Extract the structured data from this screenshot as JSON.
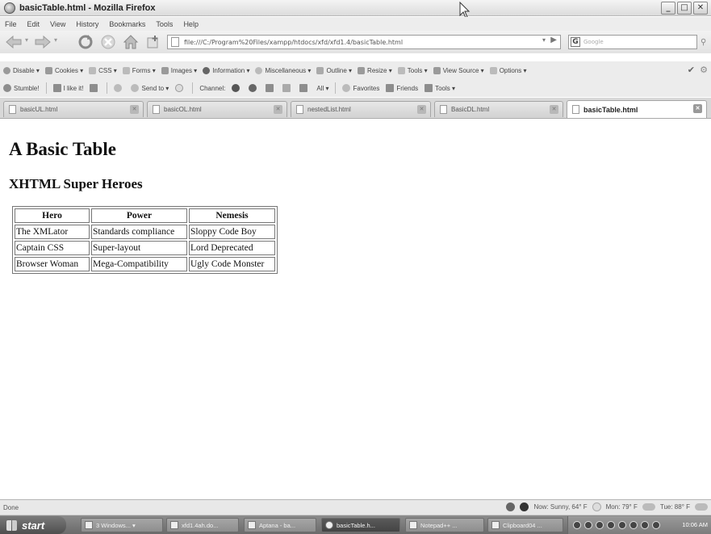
{
  "window": {
    "title": "basicTable.html - Mozilla Firefox",
    "controls": {
      "minimize": "_",
      "maximize": "□",
      "close": "✕"
    }
  },
  "menu": [
    "File",
    "Edit",
    "View",
    "History",
    "Bookmarks",
    "Tools",
    "Help"
  ],
  "nav": {
    "url": "file:///C:/Program%20Files/xampp/htdocs/xfd/xfd1.4/basicTable.html",
    "search_placeholder": "Google",
    "search_engine": "G"
  },
  "devbar": [
    "Disable",
    "Cookies",
    "CSS",
    "Forms",
    "Images",
    "Information",
    "Miscellaneous",
    "Outline",
    "Resize",
    "Tools",
    "View Source",
    "Options"
  ],
  "stumblebar": {
    "stumble": "Stumble!",
    "like": "I like it!",
    "send": "Send to",
    "channel": "Channel:",
    "all": "All",
    "favorites": "Favorites",
    "friends": "Friends",
    "tools": "Tools"
  },
  "tabs": [
    {
      "label": "basicUL.html",
      "active": false
    },
    {
      "label": "basicOL.html",
      "active": false
    },
    {
      "label": "nestedList.html",
      "active": false
    },
    {
      "label": "BasicDL.html",
      "active": false
    },
    {
      "label": "basicTable.html",
      "active": true
    }
  ],
  "page": {
    "heading": "A Basic Table",
    "subheading": "XHTML Super Heroes",
    "table": {
      "headers": [
        "Hero",
        "Power",
        "Nemesis"
      ],
      "rows": [
        [
          "The XMLator",
          "Standards compliance",
          "Sloppy Code Boy"
        ],
        [
          "Captain CSS",
          "Super-layout",
          "Lord Deprecated"
        ],
        [
          "Browser Woman",
          "Mega-Compatibility",
          "Ugly Code Monster"
        ]
      ]
    }
  },
  "status": {
    "text": "Done",
    "weather_now": "Now: Sunny, 64° F",
    "weather_mon": "Mon: 79° F",
    "weather_tue": "Tue: 88° F"
  },
  "taskbar": {
    "start": "start",
    "tasks": [
      {
        "label": "3 Windows...",
        "active": false
      },
      {
        "label": "xfd1.4ah.do...",
        "active": false
      },
      {
        "label": "Aptana - ba...",
        "active": false
      },
      {
        "label": "basicTable.h...",
        "active": true
      },
      {
        "label": "Notepad++ ...",
        "active": false
      },
      {
        "label": "Clipboard04 ...",
        "active": false
      }
    ],
    "clock": "10:06 AM"
  }
}
